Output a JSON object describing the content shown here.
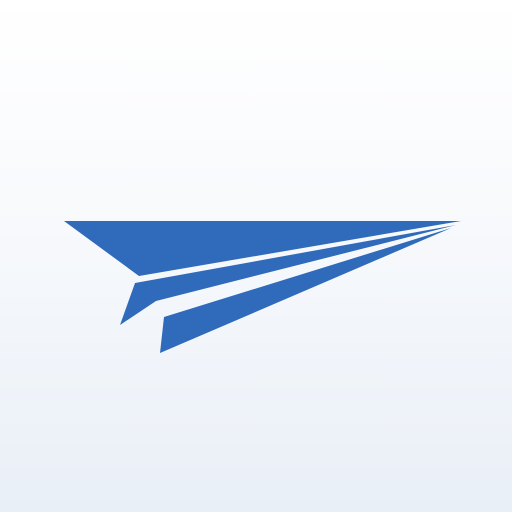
{
  "app_icon": {
    "icon_name": "paper-plane-icon",
    "colors": {
      "plane": "#2f6bba",
      "background_top": "#ffffff",
      "background_bottom": "#e9eff7"
    }
  }
}
